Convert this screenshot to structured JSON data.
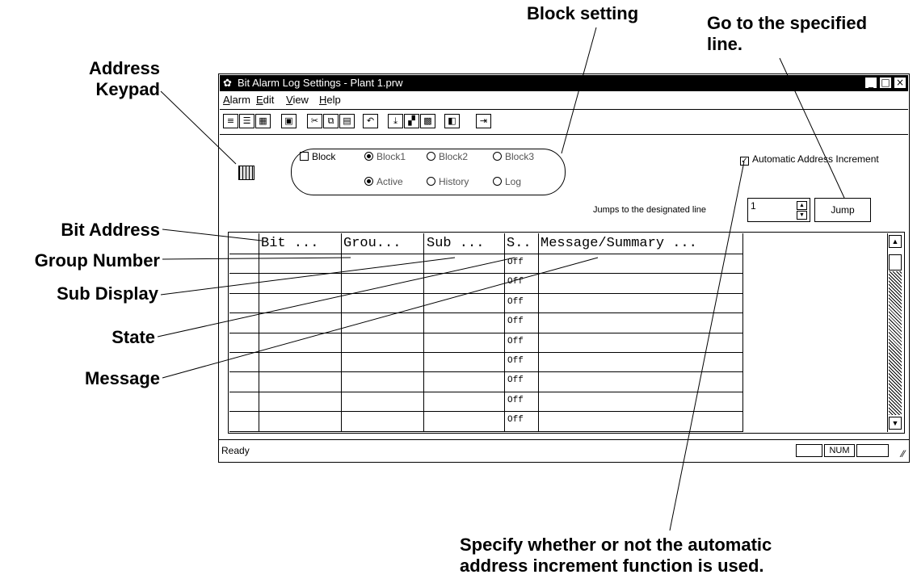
{
  "window": {
    "title": "Bit Alarm Log Settings - Plant 1.prw",
    "controls": [
      "_",
      "□",
      "×"
    ]
  },
  "menu": [
    {
      "label": "Alarm",
      "u": "A",
      "rest": "larm"
    },
    {
      "label": "Edit",
      "u": "E",
      "rest": "dit"
    },
    {
      "label": "View",
      "u": "V",
      "rest": "iew"
    },
    {
      "label": "Help",
      "u": "H",
      "rest": "elp"
    }
  ],
  "toolbar_icons": [
    "list-view-icon",
    "detail-view-icon",
    "grid-view-icon",
    "save-icon",
    "cut-icon",
    "copy-icon",
    "paste-icon",
    "undo-icon",
    "insert-row-icon",
    "block-icon",
    "pattern-icon",
    "properties-icon",
    "exit-icon"
  ],
  "block_panel": {
    "block_checkbox": "Block",
    "block_checked": false,
    "radios_row1": [
      {
        "label": "Block1",
        "selected": true
      },
      {
        "label": "Block2",
        "selected": false
      },
      {
        "label": "Block3",
        "selected": false
      }
    ],
    "radios_row2": [
      {
        "label": "Active",
        "selected": true
      },
      {
        "label": "History",
        "selected": false
      },
      {
        "label": "Log",
        "selected": false
      }
    ]
  },
  "auto_increment": {
    "label": "Automatic Address Increment",
    "checked": true
  },
  "jump": {
    "caption": "Jumps to the designated line",
    "value": "1",
    "button": "Jump"
  },
  "table": {
    "headers": [
      "Bit ...",
      "Grou...",
      "Sub ...",
      "S..",
      "Message/Summary ..."
    ],
    "state_values": [
      "Off",
      "Off",
      "Off",
      "Off",
      "Off",
      "Off",
      "Off",
      "Off",
      "Off"
    ]
  },
  "status": {
    "text": "Ready",
    "num": "NUM"
  },
  "annotations": {
    "address_keypad": [
      "Address",
      "Keypad"
    ],
    "block_setting": "Block setting",
    "go_to_line": [
      "Go to the specified",
      "line."
    ],
    "bit_address": "Bit Address",
    "group_number": "Group Number",
    "sub_display": "Sub Display",
    "state": "State",
    "message": "Message",
    "auto_increment": [
      "Specify whether or not the automatic",
      "address increment function is used."
    ]
  }
}
